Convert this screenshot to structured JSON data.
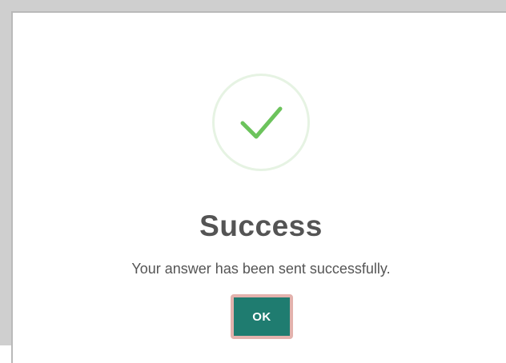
{
  "dialog": {
    "icon": "check-icon",
    "title": "Success",
    "message": "Your answer has been sent successfully.",
    "ok_label": "OK"
  },
  "colors": {
    "check": "#6cc35c",
    "circle": "#e6f3e3",
    "button_bg": "#1f7c70",
    "button_focus_ring": "#e3b2ad",
    "title_text": "#545454"
  }
}
